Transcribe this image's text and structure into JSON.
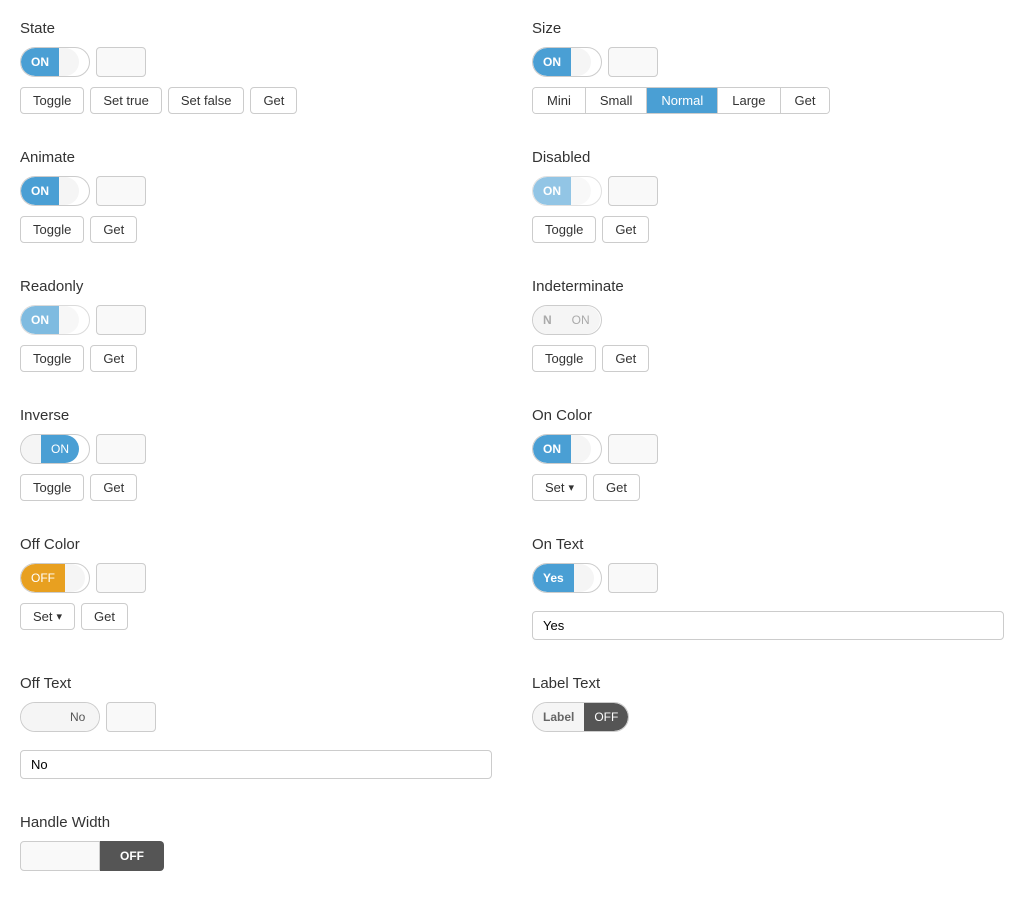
{
  "sections": {
    "state": {
      "title": "State",
      "toggle_on": "ON",
      "toggle_off": "",
      "buttons": [
        "Toggle",
        "Set true",
        "Set false",
        "Get"
      ]
    },
    "size": {
      "title": "Size",
      "toggle_on": "ON",
      "size_buttons": [
        "Mini",
        "Small",
        "Normal",
        "Large",
        "Get"
      ],
      "active": "Normal"
    },
    "animate": {
      "title": "Animate",
      "toggle_on": "ON",
      "buttons": [
        "Toggle",
        "Get"
      ]
    },
    "disabled": {
      "title": "Disabled",
      "toggle_on": "ON",
      "buttons": [
        "Toggle",
        "Get"
      ]
    },
    "readonly": {
      "title": "Readonly",
      "toggle_on": "ON",
      "buttons": [
        "Toggle",
        "Get"
      ]
    },
    "indeterminate": {
      "title": "Indeterminate",
      "toggle_left": "N",
      "toggle_right": "ON",
      "buttons": [
        "Toggle",
        "Get"
      ]
    },
    "inverse": {
      "title": "Inverse",
      "toggle_on": "ON",
      "buttons": [
        "Toggle",
        "Get"
      ]
    },
    "on_color": {
      "title": "On Color",
      "toggle_on": "ON",
      "buttons": [
        "Set",
        "Get"
      ]
    },
    "off_color": {
      "title": "Off Color",
      "toggle_off": "OFF",
      "buttons": [
        "Set",
        "Get"
      ]
    },
    "on_text": {
      "title": "On Text",
      "toggle_on": "Yes",
      "input_value": "Yes",
      "input_placeholder": "Yes"
    },
    "off_text": {
      "title": "Off Text",
      "toggle_off": "No",
      "input_value": "No",
      "input_placeholder": "No"
    },
    "label_text": {
      "title": "Label Text",
      "toggle_label": "Label",
      "toggle_off": "OFF"
    },
    "handle_width": {
      "title": "Handle Width",
      "toggle_off": "OFF"
    }
  }
}
